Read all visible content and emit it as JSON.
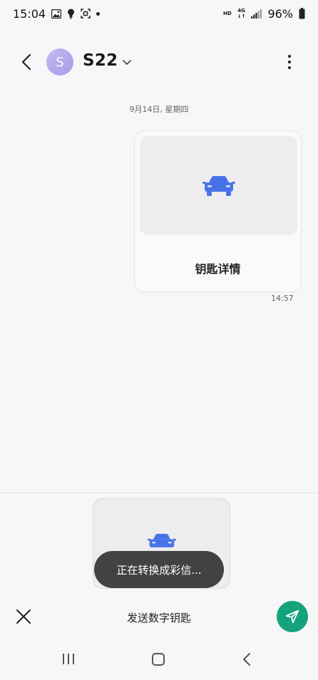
{
  "status_bar": {
    "time": "15:04",
    "left_icons": [
      "image-icon",
      "bulb-icon",
      "scan-icon",
      "dot-icon"
    ],
    "hd": "HD",
    "network_top": "4G",
    "network_bottom": "↓↑",
    "battery": "96%"
  },
  "header": {
    "avatar_letter": "S",
    "contact_name": "S22"
  },
  "conversation": {
    "date": "9月14日, 星期四",
    "message": {
      "title": "钥匙详情",
      "time": "14:57"
    }
  },
  "composer": {
    "toast": "正在转换成彩信...",
    "label": "发送数字钥匙"
  },
  "colors": {
    "car_blue": "#4a72e8",
    "send_green": "#14a37c",
    "avatar_purple": "#b3a7ee"
  }
}
